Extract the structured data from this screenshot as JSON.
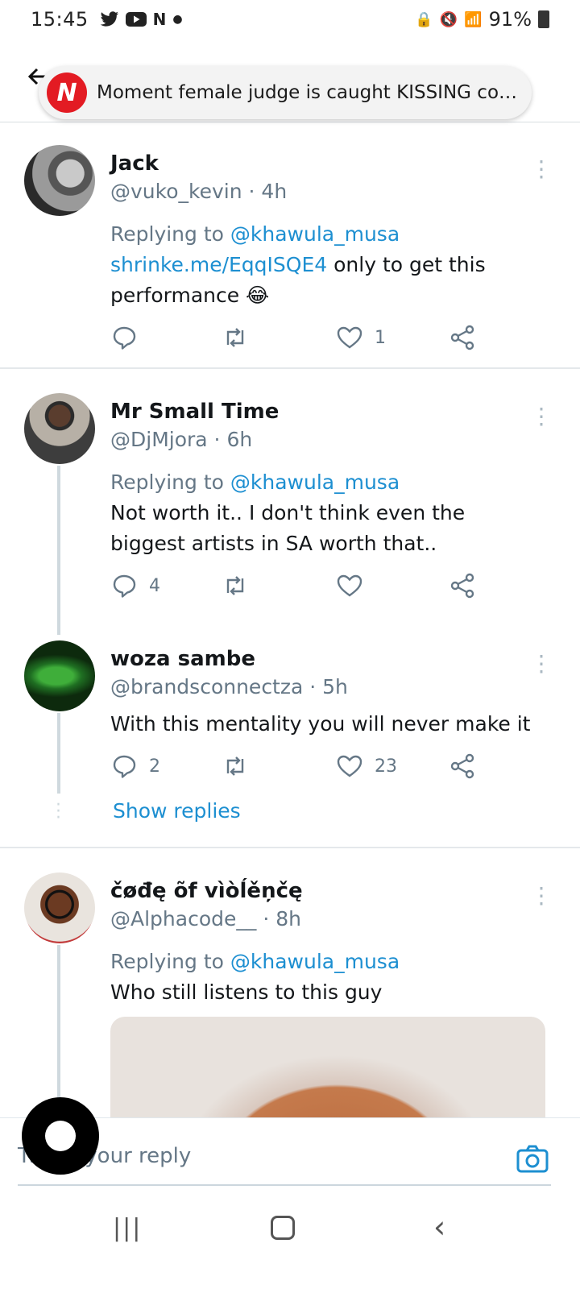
{
  "status_bar": {
    "time": "15:45",
    "notification_icons": [
      "twitter-icon",
      "youtube-icon",
      "news-icon"
    ],
    "battery": "91%"
  },
  "header": {
    "banner_text": "Moment female judge is caught KISSING cop-ki..."
  },
  "tweets": [
    {
      "name": "Jack",
      "handle": "@vuko_kevin",
      "time": "4h",
      "reply_prefix": "Replying to ",
      "reply_to": "@khawula_musa",
      "link": "shrinke.me/EqqISQE4",
      "text": " only to get this performance 😂",
      "replies": "",
      "retweets": "",
      "likes": "1"
    },
    {
      "name": "Mr Small Time",
      "handle": "@DjMjora",
      "time": "6h",
      "reply_prefix": "Replying to ",
      "reply_to": "@khawula_musa",
      "text": "Not worth it.. I don't think even the biggest artists in SA worth that..",
      "replies": "4",
      "retweets": "",
      "likes": ""
    },
    {
      "name": "woza sambe",
      "handle": "@brandsconnectza",
      "time": "5h",
      "text": "With this mentality you will never make it",
      "replies": "2",
      "retweets": "",
      "likes": "23"
    },
    {
      "name": "čøđę õf vìòĺěņčę",
      "handle": "@Alphacode__",
      "time": "8h",
      "reply_prefix": "Replying to ",
      "reply_to": "@khawula_musa",
      "text": "Who still listens to this guy"
    }
  ],
  "show_replies_label": "Show replies",
  "reply_bar": {
    "placeholder": "Tweet your reply"
  },
  "colors": {
    "link": "#1d8fd1",
    "secondary_text": "#657786",
    "brand_red": "#e31b23"
  }
}
